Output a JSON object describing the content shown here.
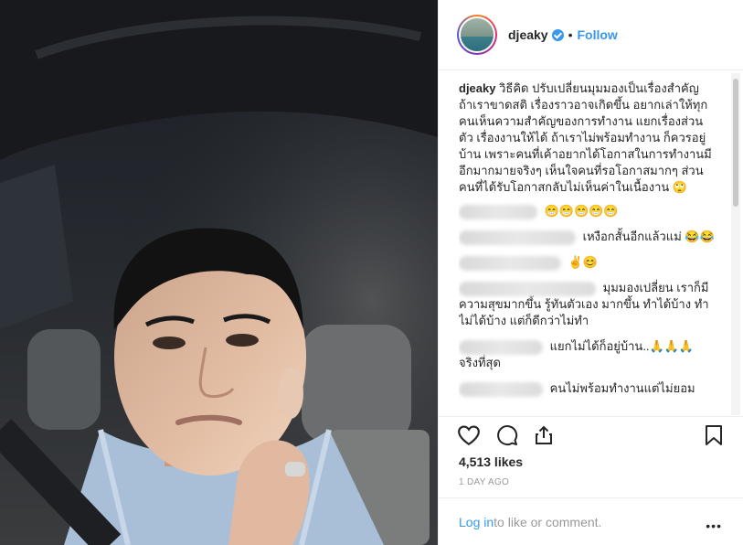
{
  "post": {
    "username": "djeaky",
    "follow_label": "Follow",
    "dot_separator": "•",
    "caption": {
      "username": "djeaky",
      "text": "วิธีคิด ปรับเปลี่ยนมุมมองเป็นเรื่องสำคัญ ถ้าเราขาดสติ เรื่องราวอาจเกิดขึ้น อยากเล่าให้ทุกคนเห็นความสำคัญของการทำงาน แยกเรื่องส่วนตัว เรื่องงานให้ได้ ถ้าเราไม่พร้อมทำงาน ก็ควรอยู่บ้าน เพราะคนที่เค้าอยากได้โอกาสในการทำงานมีอีกมากมายจริงๆ เห็นใจคนที่รอโอกาสมากๆ ส่วนคนที่ได้รับโอกาสกลับไม่เห็นค่าในเนื้องาน 🙄"
    },
    "comments": [
      {
        "text": "😁😁😁😁😁"
      },
      {
        "text": "เหงือกสั้นอีกแล้วแม่ 😂😂"
      },
      {
        "text": "✌😊"
      },
      {
        "text": "มุมมองเปลี่ยน เราก็มีความสุขมากขึ้น รู้ทันตัวเอง มากขึ้น ทำได้บ้าง ทำไม่ได้บ้าง แต่ก็ดีกว่าไม่ทำ"
      },
      {
        "text": "แยกไม่ได้ก็อยู่บ้าน..🙏🙏🙏 จริงที่สุด"
      },
      {
        "text": "คนไม่พร้อมทำงานแต่ไม่ยอม"
      }
    ],
    "likes": "4,513 likes",
    "time": "1 DAY AGO",
    "footer": {
      "login_label": "Log in",
      "rest": " to like or comment.",
      "more": "•••"
    },
    "icons": {
      "like": "heart-icon",
      "comment": "comment-bubble-icon",
      "share": "share-icon",
      "save": "bookmark-icon",
      "verified": "verified-badge-icon"
    },
    "colors": {
      "accent": "#3897f0",
      "text": "#262626",
      "muted": "#999999"
    }
  }
}
